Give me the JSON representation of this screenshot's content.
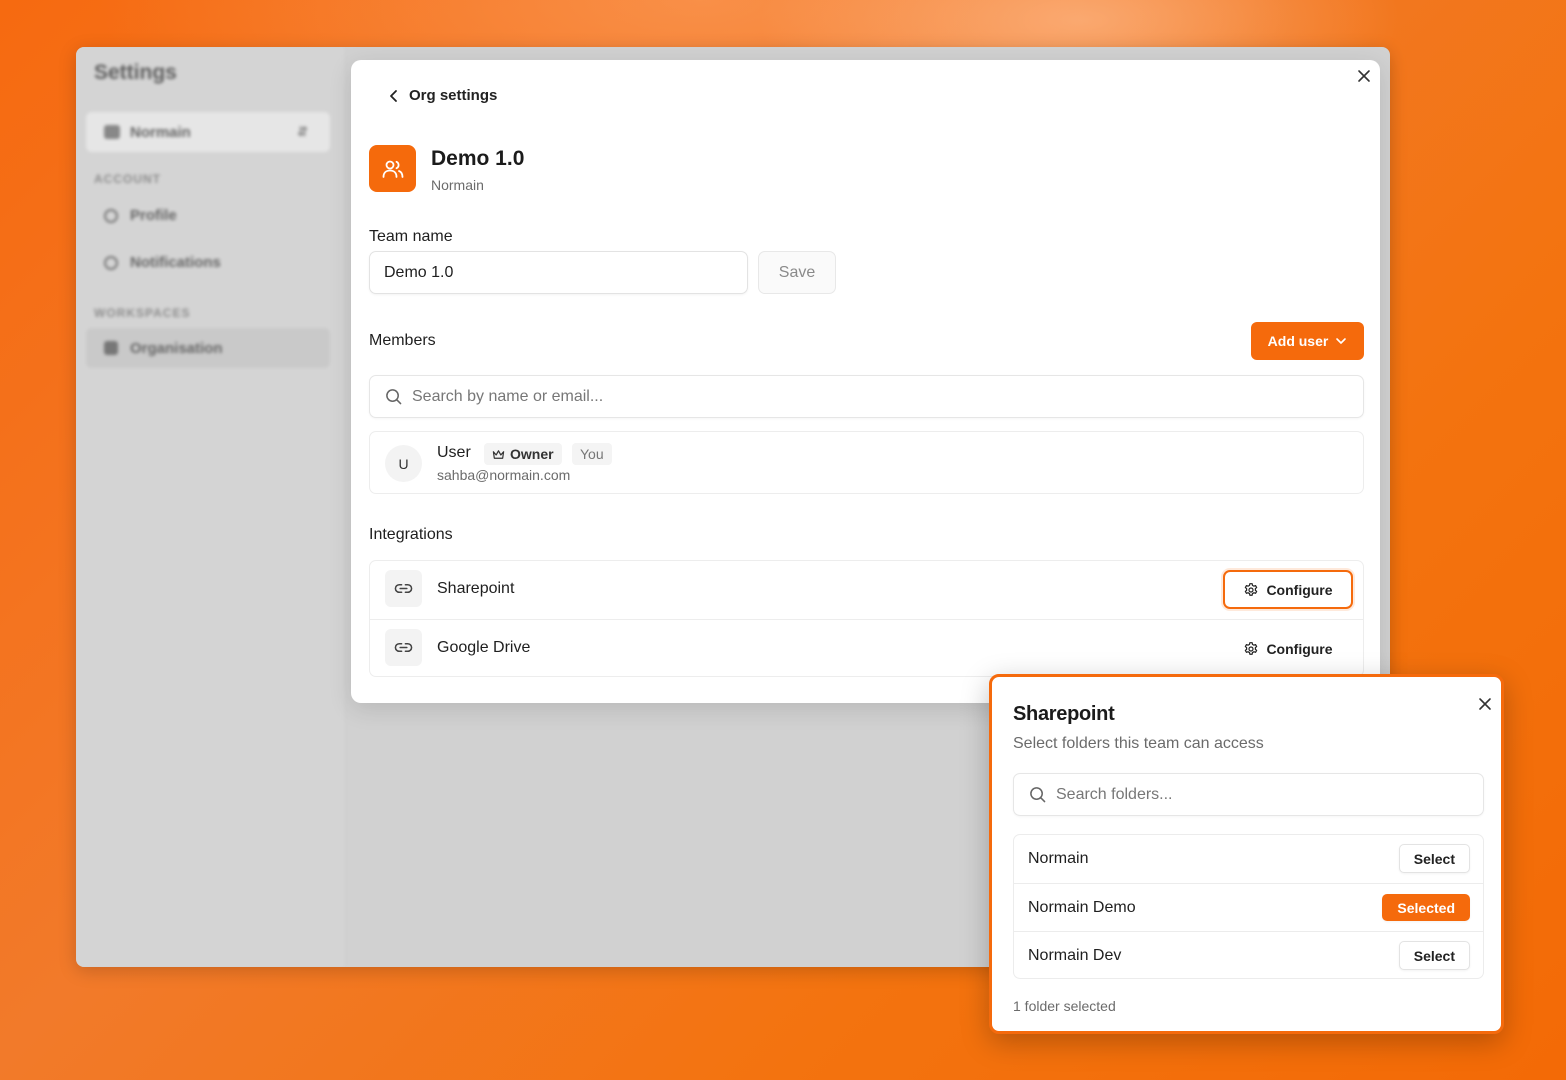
{
  "background": {
    "title": "Settings",
    "org_switcher": "Normain",
    "section_account": "ACCOUNT",
    "item_profile": "Profile",
    "item_notifications": "Notifications",
    "section_workspaces": "WORKSPACES",
    "item_organisation": "Organisation"
  },
  "modal": {
    "back_label": "Org settings",
    "team": {
      "title": "Demo 1.0",
      "org": "Normain"
    },
    "team_name": {
      "label": "Team name",
      "value": "Demo 1.0",
      "save_label": "Save"
    },
    "members": {
      "heading": "Members",
      "add_user_label": "Add user",
      "search_placeholder": "Search by name or email...",
      "list": [
        {
          "initial": "U",
          "name": "User",
          "role_badge": "Owner",
          "you_badge": "You",
          "email": "sahba@normain.com"
        }
      ]
    },
    "integrations": {
      "heading": "Integrations",
      "items": [
        {
          "name": "Sharepoint",
          "action": "Configure"
        },
        {
          "name": "Google Drive",
          "action": "Configure"
        }
      ]
    }
  },
  "popup": {
    "title": "Sharepoint",
    "subtitle": "Select folders this team can access",
    "search_placeholder": "Search folders...",
    "folders": [
      {
        "name": "Normain",
        "action": "Select"
      },
      {
        "name": "Normain Demo",
        "action": "Selected"
      },
      {
        "name": "Normain Dev",
        "action": "Select"
      }
    ],
    "footer": "1 folder selected"
  },
  "colors": {
    "accent": "#f56a0c",
    "background": "#f36a06"
  }
}
